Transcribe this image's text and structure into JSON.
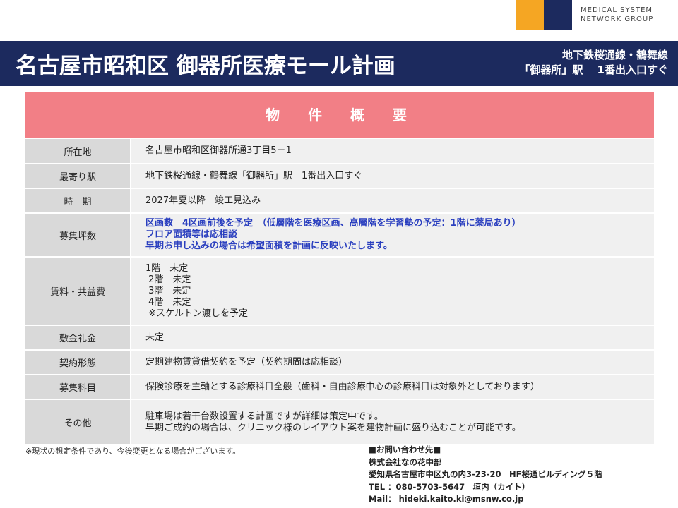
{
  "logo": {
    "line1": "MEDICAL SYSTEM",
    "line2": "NETWORK GROUP",
    "colors": {
      "orange": "#f5a623",
      "navy": "#1c2a5e"
    }
  },
  "header": {
    "title": "名古屋市昭和区 御器所医療モール計画",
    "sub_line1": "地下鉄桜通線・鶴舞線",
    "sub_line2": "「御器所」駅　 1番出入口すぐ"
  },
  "table": {
    "title": "物　件　概　要",
    "rows": [
      {
        "label": "所在地",
        "lines": [
          "名古屋市昭和区御器所通3丁目5－1"
        ]
      },
      {
        "label": "最寄り駅",
        "lines": [
          "地下鉄桜通線・鶴舞線「御器所」駅　1番出入口すぐ"
        ]
      },
      {
        "label": "時　期",
        "lines": [
          "2027年夏以降　竣工見込み"
        ]
      },
      {
        "label": "募集坪数",
        "lines": [
          "区画数　4区画前後を予定　（低層階を医療区画、高層階を学習塾の予定：1階に薬局あり）",
          "フロア面積等は応相談",
          "早期お申し込みの場合は希望面積を計画に反映いたします。"
        ]
      },
      {
        "label": "賃料・共益費",
        "lines": [
          "1階　未定",
          " 2階　未定",
          " 3階　未定",
          " 4階　未定",
          " ※スケルトン渡しを予定"
        ]
      },
      {
        "label": "敷金礼金",
        "lines": [
          "未定"
        ]
      },
      {
        "label": "契約形態",
        "lines": [
          "定期建物賃貸借契約を予定（契約期間は応相談）"
        ]
      },
      {
        "label": "募集科目",
        "lines": [
          "保険診療を主軸とする診療科目全般（歯科・自由診療中心の診療科目は対象外としております）"
        ]
      },
      {
        "label": "その他",
        "lines": [
          "駐車場は若干台数設置する計画ですが詳細は策定中です。",
          "早期ご成約の場合は、クリニック様のレイアウト案を建物計画に盛り込むことが可能です。"
        ]
      }
    ]
  },
  "note": "※現状の想定条件であり、今後変更となる場合がございます。",
  "contact": {
    "heading": "■お問い合わせ先■",
    "company": "株式会社なの花中部",
    "address": "愛知県名古屋市中区丸の内3-23-20　HF桜通ビルディング５階",
    "tel": "TEL ：080-5703-5647　垣内（カイト）",
    "mail": "Mail： hideki.kaito.ki@msnw.co.jp"
  }
}
